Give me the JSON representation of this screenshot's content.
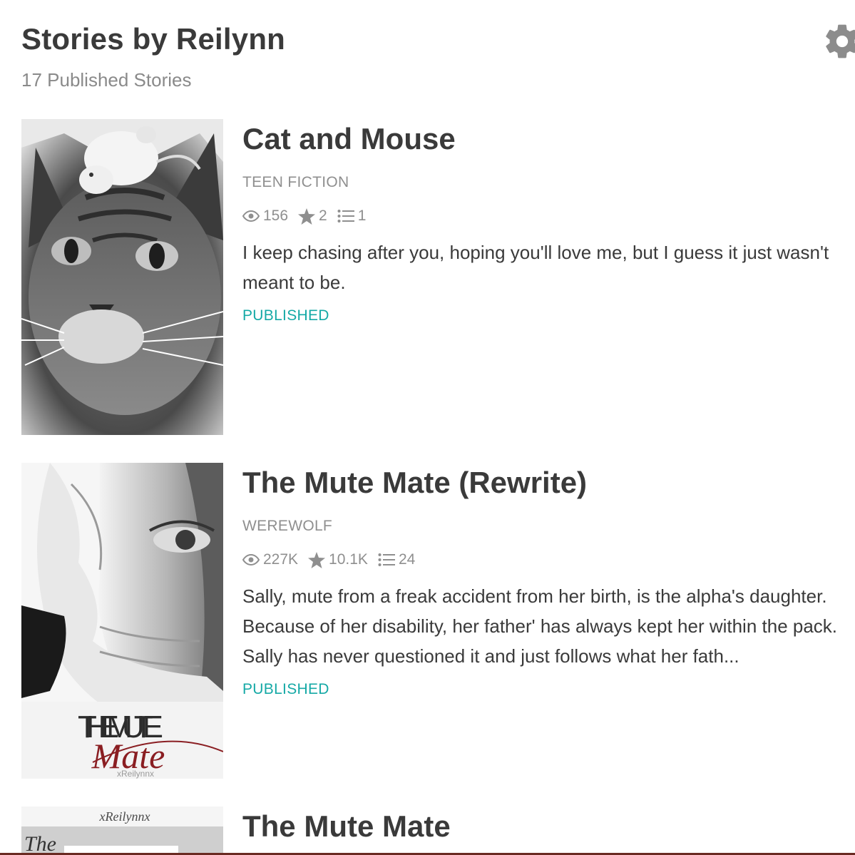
{
  "header": {
    "title": "Stories by Reilynn",
    "subtitle": "17 Published Stories",
    "settings_icon": "gear-icon"
  },
  "stories": [
    {
      "title": "Cat and Mouse",
      "genre": "TEEN FICTION",
      "reads": "156",
      "votes": "2",
      "parts": "1",
      "description": "I keep chasing after you, hoping you'll love me, but I guess it just wasn't meant to be.",
      "status": "PUBLISHED"
    },
    {
      "title": "The Mute Mate (Rewrite)",
      "genre": "WEREWOLF",
      "reads": "227K",
      "votes": "10.1K",
      "parts": "24",
      "description": "Sally, mute from a freak accident from her birth, is the alpha's daughter. Because of her disability, her father' has always kept her within the pack. Sally has never questioned it and just follows what her fath...",
      "status": "PUBLISHED",
      "cover_text": {
        "line1": "THE MUTE",
        "line2": "Mate",
        "credit": "xReilynnx"
      }
    },
    {
      "title": "The Mute Mate",
      "cover_text": {
        "author": "xReilynnx",
        "word": "The"
      }
    }
  ],
  "icons": {
    "reads": "eye-icon",
    "votes": "star-icon",
    "parts": "list-icon"
  },
  "colors": {
    "status": "#15a9a6",
    "title": "#3a3a3a",
    "meta": "#8f8f8f"
  }
}
